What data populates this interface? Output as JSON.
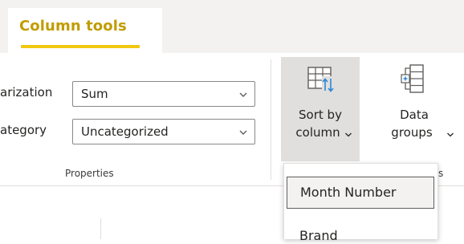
{
  "tabs": {
    "active_label": "Column tools"
  },
  "properties": {
    "summarization_label": "arization",
    "summarization_value": "Sum",
    "category_label": "ategory",
    "category_value": "Uncategorized",
    "group_label": "Properties"
  },
  "sort_by_column": {
    "line1": "Sort by",
    "line2": "column",
    "menu_items": [
      "Month Number",
      "Brand"
    ],
    "selected_item": "Month Number"
  },
  "data_groups": {
    "line1": "Data",
    "line2": "groups",
    "group_label_fragment": "s"
  },
  "colors": {
    "accent": "#f2c811",
    "tab_text": "#c19c00",
    "ribbon_bg": "#ffffff",
    "tabstrip_bg": "#f3f2f1",
    "pressed_bg": "#e1dfdd",
    "icon_blue": "#2b88d8"
  }
}
